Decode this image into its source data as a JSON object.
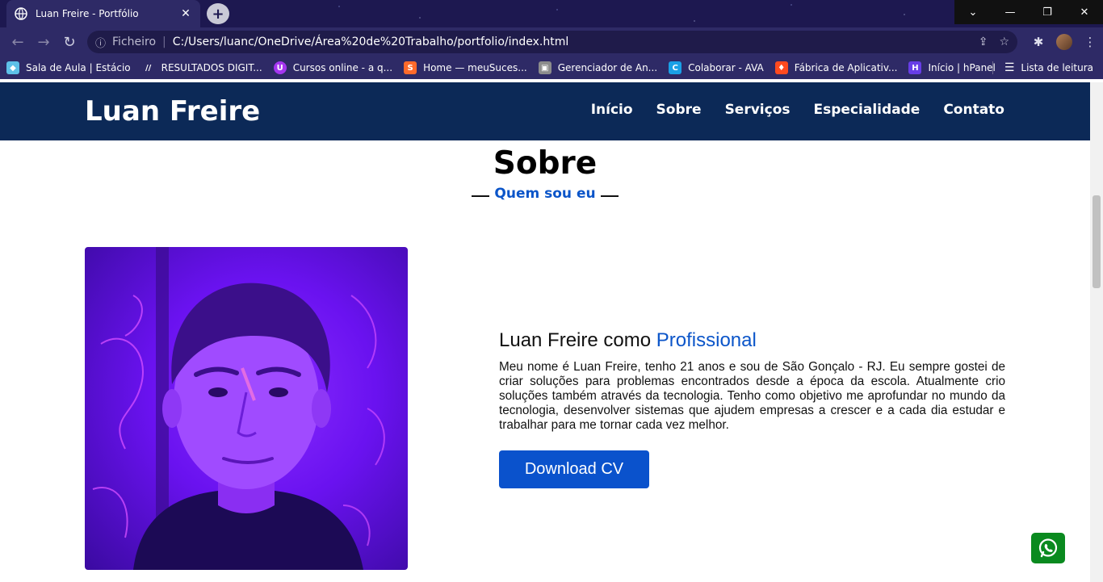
{
  "browser": {
    "tab_title": "Luan Freire - Portfólio",
    "tab_close": "✕",
    "new_tab": "+",
    "address_prefix": "Ficheiro",
    "address_sep": "|",
    "url": "C:/Users/luanc/OneDrive/Área%20de%20Trabalho/portfolio/index.html",
    "bookmarks": [
      {
        "label": "Sala de Aula | Estácio",
        "icon": "diamond-icon",
        "color": "#5ec0e8"
      },
      {
        "label": "RESULTADOS DIGIT...",
        "icon": "slashes-icon",
        "color": "#ffffff"
      },
      {
        "label": "Cursos online - a q...",
        "icon": "udemy-icon",
        "color": "#a435f0"
      },
      {
        "label": "Home — meuSuces...",
        "icon": "s-logo-icon",
        "color": "#ff6a2b"
      },
      {
        "label": "Gerenciador de An...",
        "icon": "image-icon",
        "color": "#8c8c8c"
      },
      {
        "label": "Colaborar - AVA",
        "icon": "c-logo-icon",
        "color": "#1aa0e6"
      },
      {
        "label": "Fábrica de Aplicativ...",
        "icon": "flame-icon",
        "color": "#ff4a1f"
      },
      {
        "label": "Início | hPanel",
        "icon": "h-logo-icon",
        "color": "#673de6"
      }
    ],
    "reading_list": "Lista de leitura"
  },
  "site": {
    "brand": "Luan Freire",
    "menu": [
      "Início",
      "Sobre",
      "Serviços",
      "Especialidade",
      "Contato"
    ]
  },
  "about": {
    "title": "Sobre",
    "subtitle": "Quem sou eu",
    "heading_main": "Luan Freire como ",
    "heading_accent": "Profissional",
    "paragraph": "Meu nome é Luan Freire, tenho 21 anos e sou de São Gonçalo - RJ. Eu sempre gostei de criar soluções para problemas encontrados desde a época da escola. Atualmente crio soluções também através da tecnologia. Tenho como objetivo me aprofundar no mundo da tecnologia, desenvolver sistemas que ajudem empresas a crescer e a cada dia estudar e trabalhar para me tornar cada vez melhor.",
    "cv_button": "Download CV"
  },
  "colors": {
    "nav_bg": "#0c2957",
    "accent": "#0b55c9",
    "whatsapp": "#0a8a1f"
  }
}
